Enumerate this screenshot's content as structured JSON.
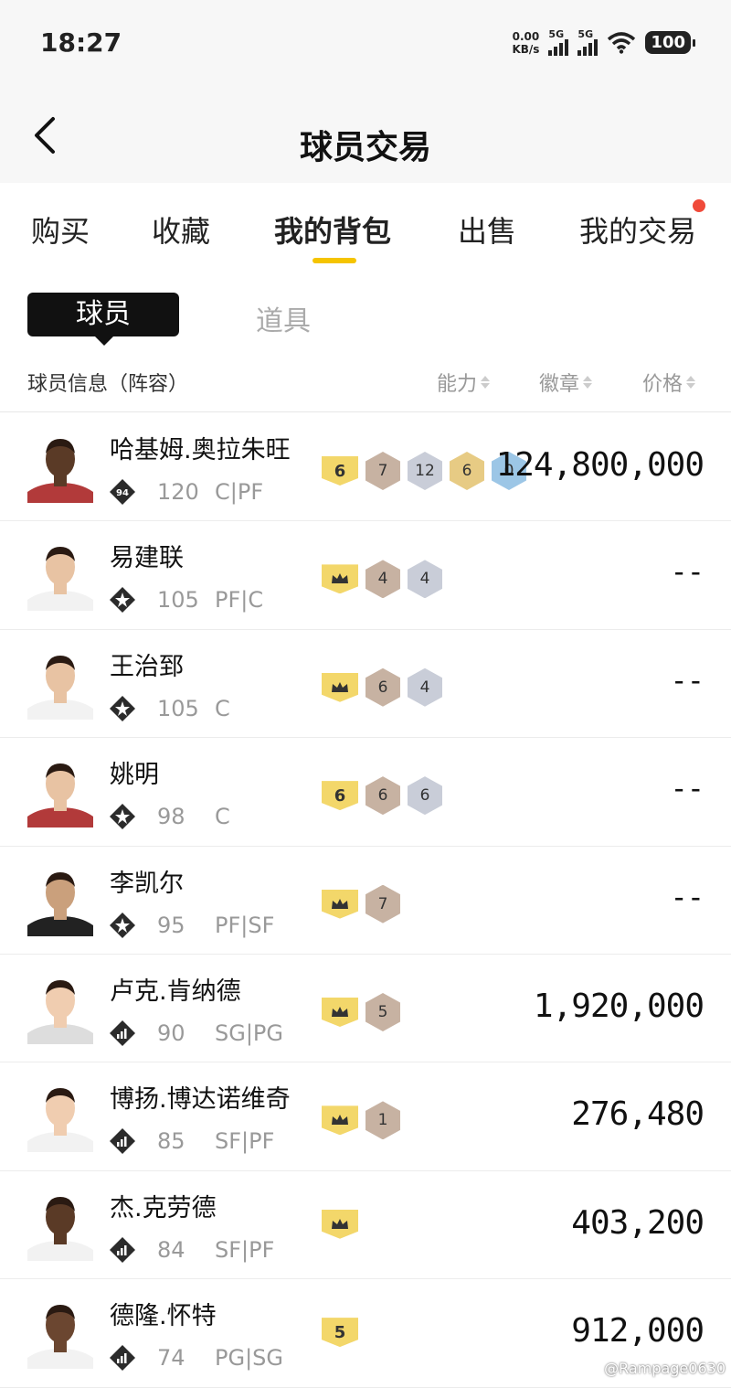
{
  "status_bar": {
    "time": "18:27",
    "net_speed": "0.00",
    "net_unit": "KB/s",
    "sim1": "5G",
    "sim2": "5G",
    "battery": "100"
  },
  "header": {
    "title": "球员交易",
    "back_icon": "chevron-left-icon"
  },
  "tabs": [
    {
      "label": "购买"
    },
    {
      "label": "收藏"
    },
    {
      "label": "我的背包",
      "active": true
    },
    {
      "label": "出售"
    },
    {
      "label": "我的交易",
      "has_notification_dot": true
    }
  ],
  "segments": {
    "active": "球员",
    "inactive": "道具"
  },
  "columns": {
    "info": "球员信息（阵容）",
    "ability": "能力",
    "badges": "徽章",
    "price": "价格"
  },
  "colors": {
    "accent": "#f5c400",
    "notification": "#f04a3a"
  },
  "players": [
    {
      "name": "哈基姆.奥拉朱旺",
      "tier_badge": "94",
      "rating": "120",
      "position": "C|PF",
      "level": "6",
      "badges": [
        {
          "v": "7",
          "t": "bronze"
        },
        {
          "v": "12",
          "t": "silver"
        },
        {
          "v": "6",
          "t": "gold"
        },
        {
          "v": "0",
          "t": "hof"
        }
      ],
      "price": "124,800,000",
      "skin": "#5a3a26",
      "shirt": "#b23a3a"
    },
    {
      "name": "易建联",
      "tier_badge": "",
      "rating": "105",
      "position": "PF|C",
      "level": "crown",
      "badges": [
        {
          "v": "4",
          "t": "bronze"
        },
        {
          "v": "4",
          "t": "silver"
        }
      ],
      "price": "--",
      "skin": "#e8c3a3",
      "shirt": "#f2f2f2"
    },
    {
      "name": "王治郅",
      "tier_badge": "",
      "rating": "105",
      "position": "C",
      "level": "crown",
      "badges": [
        {
          "v": "6",
          "t": "bronze"
        },
        {
          "v": "4",
          "t": "silver"
        }
      ],
      "price": "--",
      "skin": "#e8c3a3",
      "shirt": "#f2f2f2"
    },
    {
      "name": "姚明",
      "tier_badge": "",
      "rating": "98",
      "position": "C",
      "level": "6",
      "badges": [
        {
          "v": "6",
          "t": "bronze"
        },
        {
          "v": "6",
          "t": "silver"
        }
      ],
      "price": "--",
      "skin": "#e8c3a3",
      "shirt": "#b23a3a"
    },
    {
      "name": "李凯尔",
      "tier_badge": "",
      "rating": "95",
      "position": "PF|SF",
      "level": "crown",
      "badges": [
        {
          "v": "7",
          "t": "bronze"
        }
      ],
      "price": "--",
      "skin": "#caa07c",
      "shirt": "#222"
    },
    {
      "name": "卢克.肯纳德",
      "tier_badge": "",
      "rating": "90",
      "position": "SG|PG",
      "level": "crown",
      "badges": [
        {
          "v": "5",
          "t": "bronze"
        }
      ],
      "price": "1,920,000",
      "skin": "#f0cdb0",
      "shirt": "#ddd"
    },
    {
      "name": "博扬.博达诺维奇",
      "tier_badge": "",
      "rating": "85",
      "position": "SF|PF",
      "level": "crown",
      "badges": [
        {
          "v": "1",
          "t": "bronze"
        }
      ],
      "price": "276,480",
      "skin": "#f0cdb0",
      "shirt": "#f2f2f2"
    },
    {
      "name": "杰.克劳德",
      "tier_badge": "",
      "rating": "84",
      "position": "SF|PF",
      "level": "crown",
      "badges": [],
      "price": "403,200",
      "skin": "#5a3a26",
      "shirt": "#f2f2f2"
    },
    {
      "name": "德隆.怀特",
      "tier_badge": "",
      "rating": "74",
      "position": "PG|SG",
      "level": "5",
      "badges": [],
      "price": "912,000",
      "skin": "#6b4630",
      "shirt": "#f2f2f2"
    }
  ],
  "watermark": "@Rampage0630"
}
